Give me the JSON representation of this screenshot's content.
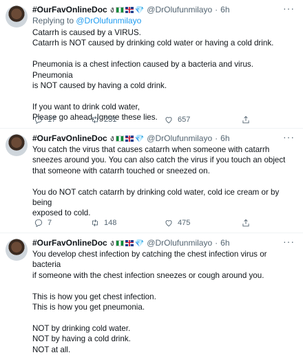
{
  "author": {
    "name": "#OurFavOnlineDoc",
    "handle": "@DrOlufunmilayo",
    "script_badge": "ง"
  },
  "tweets": [
    {
      "time": "6h",
      "reply_to_prefix": "Replying to ",
      "reply_to_user": "@DrOlufunmilayo",
      "lines": [
        "Catarrh is caused by a VIRUS.",
        "Catarrh is NOT caused by drinking cold water or having a cold drink.",
        "",
        "Pneumonia is a chest infection caused by a bacteria and virus. Pneumonia",
        "is NOT caused by having a cold drink.",
        "",
        "If you want to drink cold water,",
        "Please go ahead. Ignore these lies."
      ],
      "replies": "17",
      "retweets": "231",
      "likes": "657"
    },
    {
      "time": "6h",
      "lines": [
        "You catch the virus that causes catarrh when someone with catarrh",
        "sneezes around you. You can also catch the virus if you touch an object",
        "that someone with catarrh touched or sneezed on.",
        "",
        "You do NOT catch catarrh by drinking cold water, cold ice cream or by being",
        "exposed to cold."
      ],
      "replies": "7",
      "retweets": "148",
      "likes": "475"
    },
    {
      "time": "6h",
      "lines": [
        "You develop chest infection by catching the chest infection virus or bacteria",
        "if someone with the chest infection sneezes or cough around you.",
        "",
        "This is how you get chest infection.",
        "This is how you get pneumonia.",
        "",
        "NOT by drinking cold water.",
        "NOT by having a cold drink.",
        "NOT at all."
      ]
    }
  ],
  "icons": [
    "reply-icon",
    "retweet-icon",
    "like-icon",
    "share-icon",
    "more-icon"
  ]
}
